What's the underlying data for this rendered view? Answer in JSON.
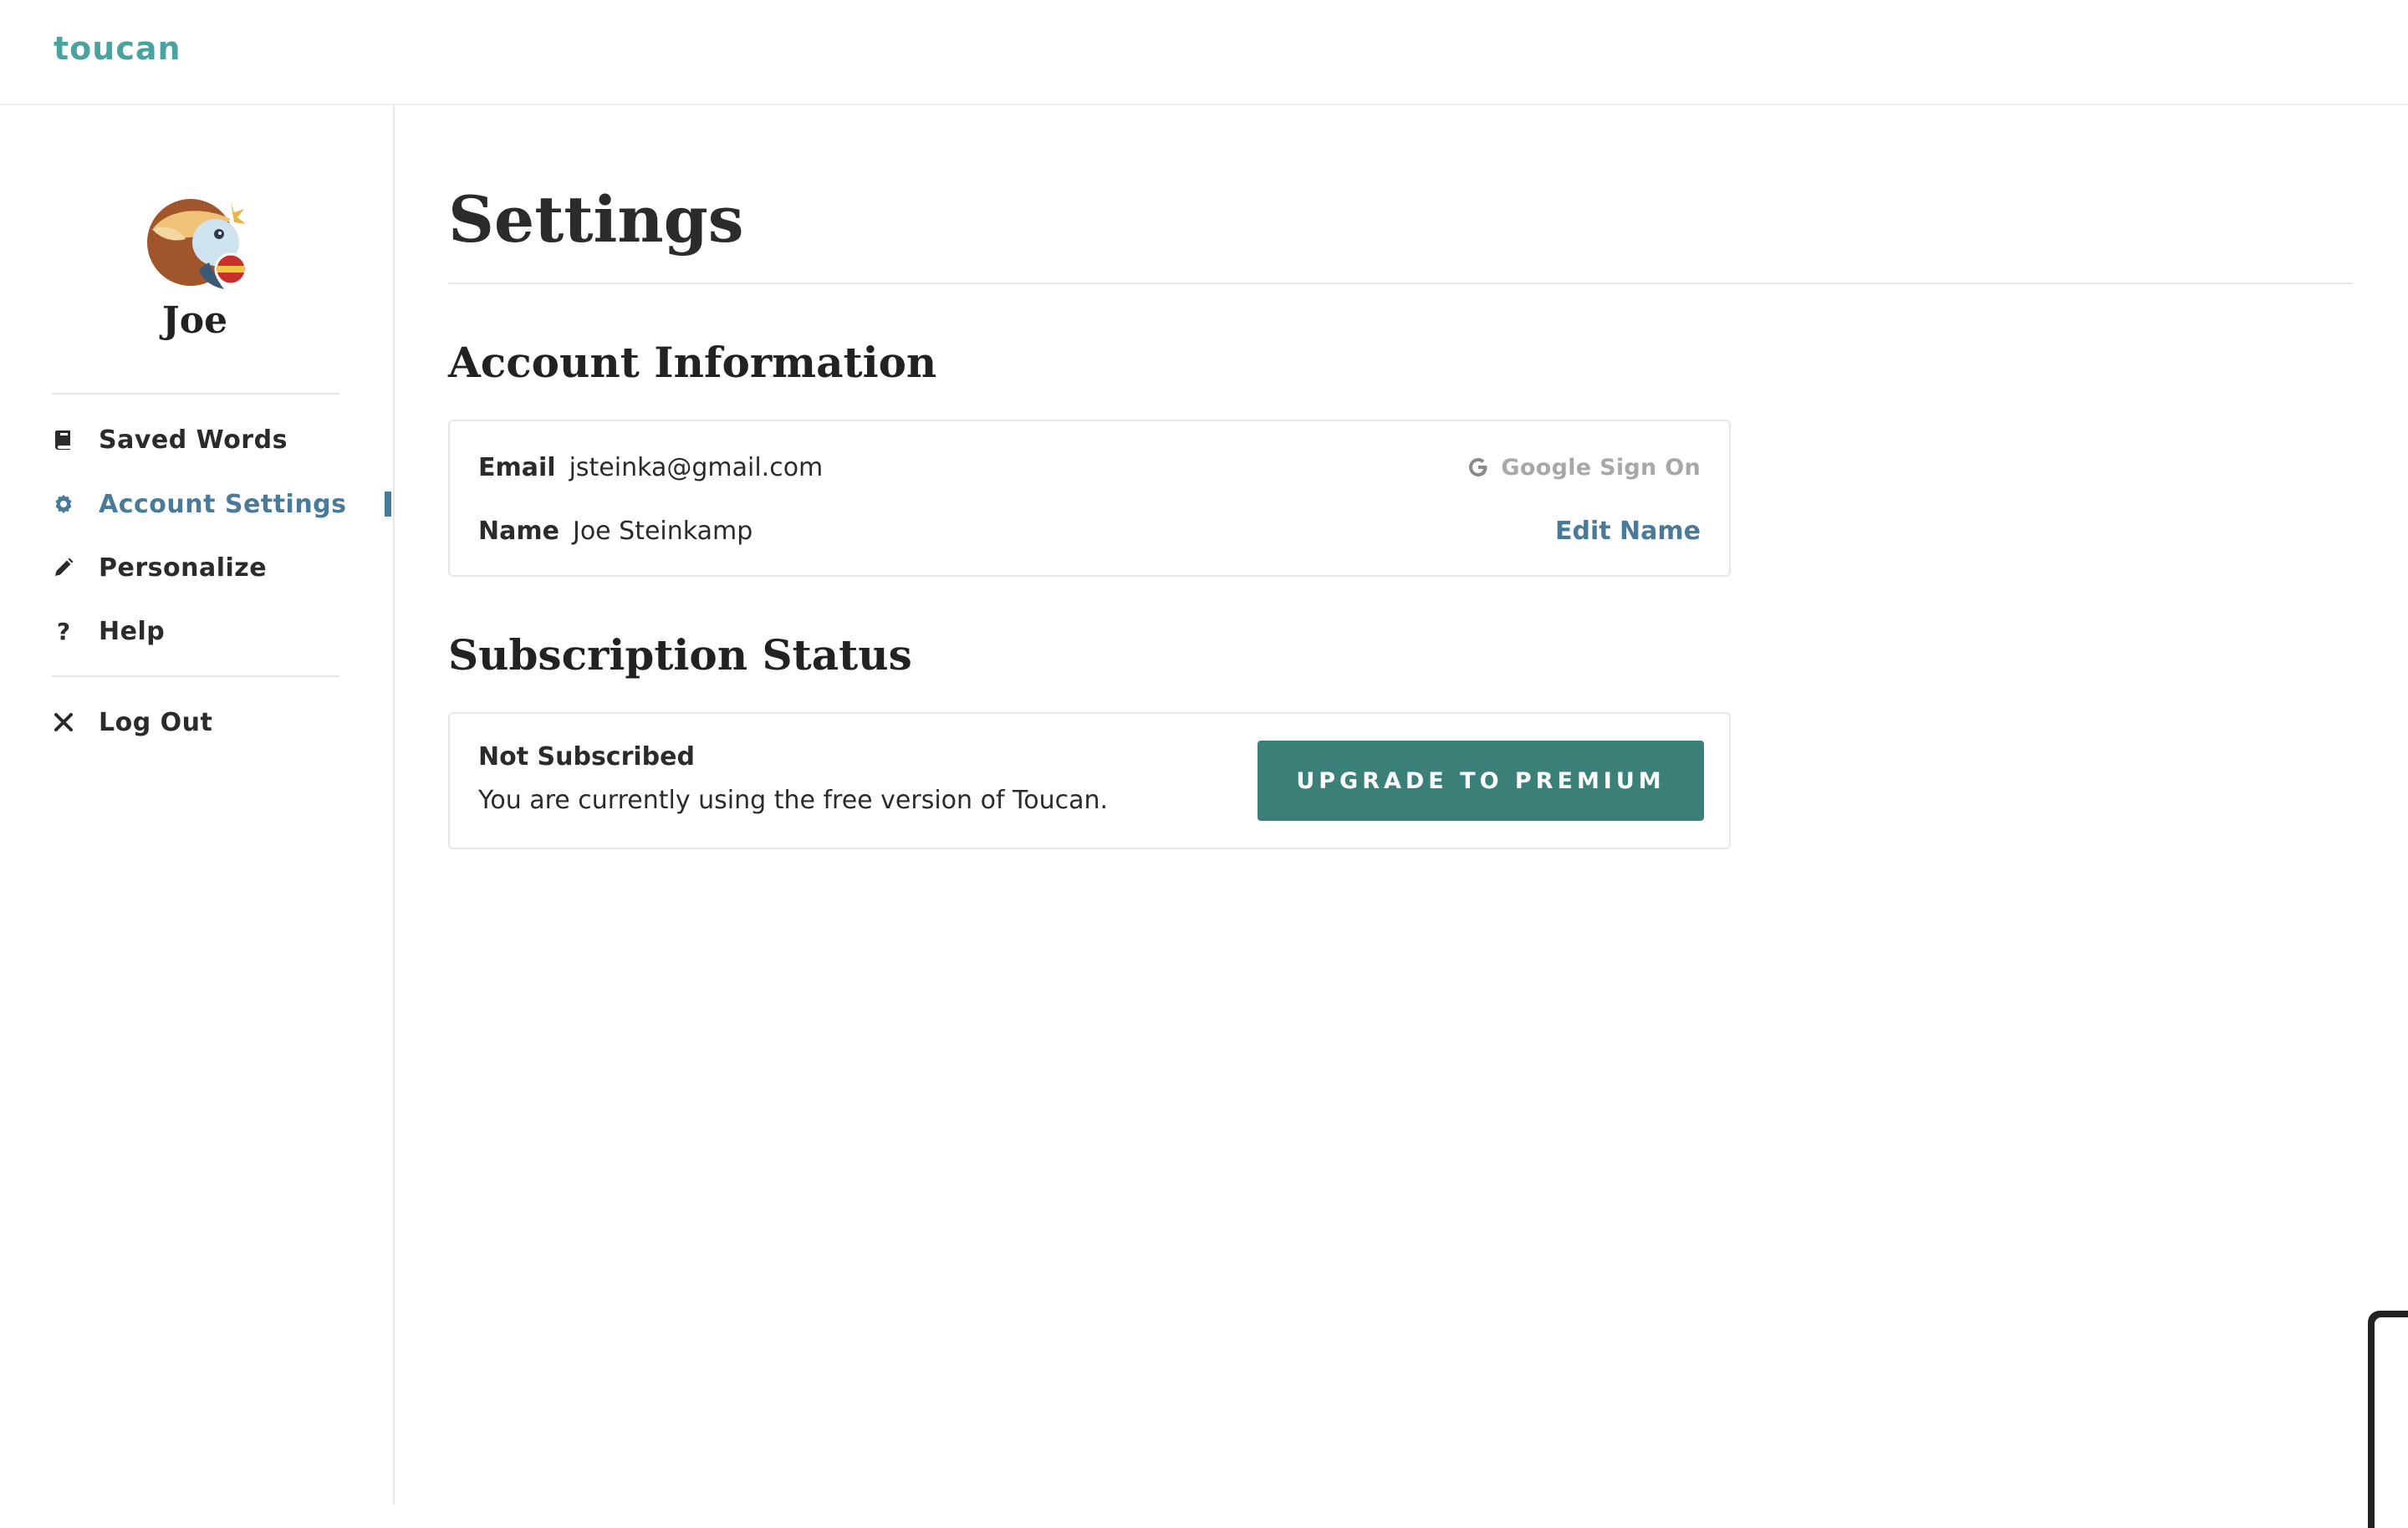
{
  "app": {
    "logo": "toucan"
  },
  "sidebar": {
    "user_name": "Joe",
    "items": [
      {
        "label": "Saved Words",
        "icon": "book-icon"
      },
      {
        "label": "Account Settings",
        "icon": "gear-icon",
        "active": true
      },
      {
        "label": "Personalize",
        "icon": "pencil-icon"
      },
      {
        "label": "Help",
        "icon": "question-icon"
      }
    ],
    "logout": {
      "label": "Log Out",
      "icon": "close-icon"
    }
  },
  "main": {
    "title": "Settings",
    "account": {
      "heading": "Account Information",
      "email_label": "Email",
      "email_value": "jsteinka@gmail.com",
      "sign_on_label": "Google Sign On",
      "name_label": "Name",
      "name_value": "Joe Steinkamp",
      "edit_name_label": "Edit Name"
    },
    "subscription": {
      "heading": "Subscription Status",
      "status": "Not Subscribed",
      "description": "You are currently using the free version of Toucan.",
      "upgrade_label": "UPGRADE TO PREMIUM"
    }
  },
  "colors": {
    "logo": "#4aa3a0",
    "accent": "#4a7a99",
    "button": "#3a8078"
  }
}
